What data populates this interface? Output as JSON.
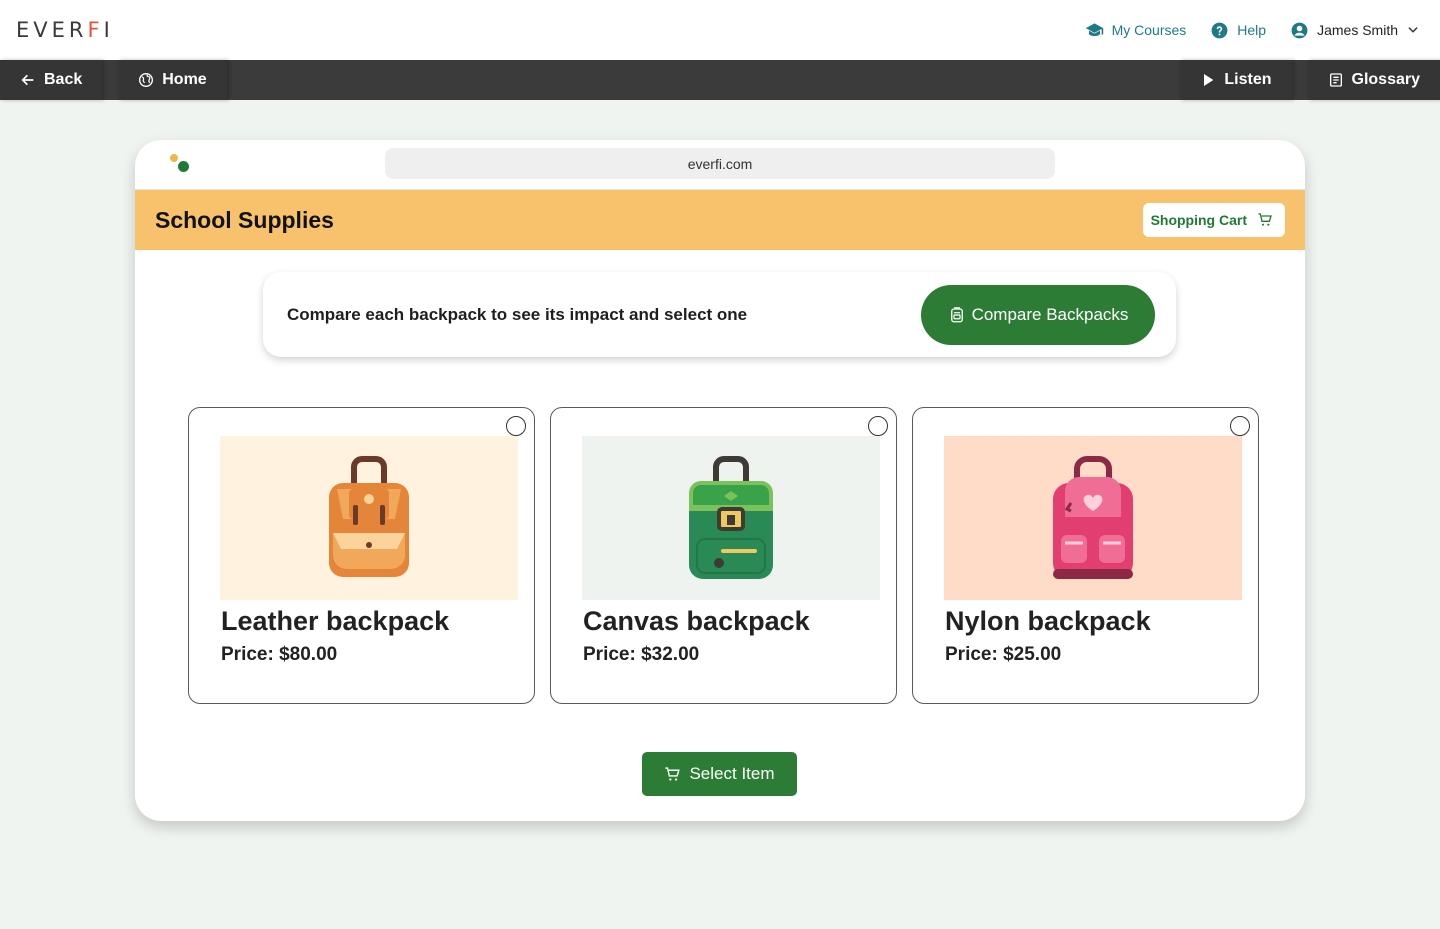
{
  "header": {
    "logo": {
      "text": "EVER",
      "accent": "F",
      "suffix": "I"
    },
    "my_courses": "My Courses",
    "help": "Help",
    "user_name": "James Smith"
  },
  "nav": {
    "back": "Back",
    "home": "Home",
    "listen": "Listen",
    "glossary": "Glossary"
  },
  "browser": {
    "url": "everfi.com"
  },
  "store": {
    "title": "School Supplies",
    "cart_label": "Shopping Cart",
    "instruction": "Compare each backpack to see its impact and select one",
    "compare_label": "Compare Backpacks",
    "select_label": "Select Item",
    "products": [
      {
        "name": "Leather backpack",
        "price": "Price: $80.00",
        "image_bg": "#fff3df",
        "icon": "leather-backpack-icon"
      },
      {
        "name": "Canvas backpack",
        "price": "Price: $32.00",
        "image_bg": "#eef3ef",
        "icon": "canvas-backpack-icon"
      },
      {
        "name": "Nylon backpack",
        "price": "Price: $25.00",
        "image_bg": "#ffdcc8",
        "icon": "nylon-backpack-icon"
      }
    ]
  },
  "colors": {
    "brand_green": "#2d7c35",
    "store_bar": "#f8c26c",
    "link_teal": "#1e7a86",
    "nav_dark": "#3b3b3b"
  }
}
